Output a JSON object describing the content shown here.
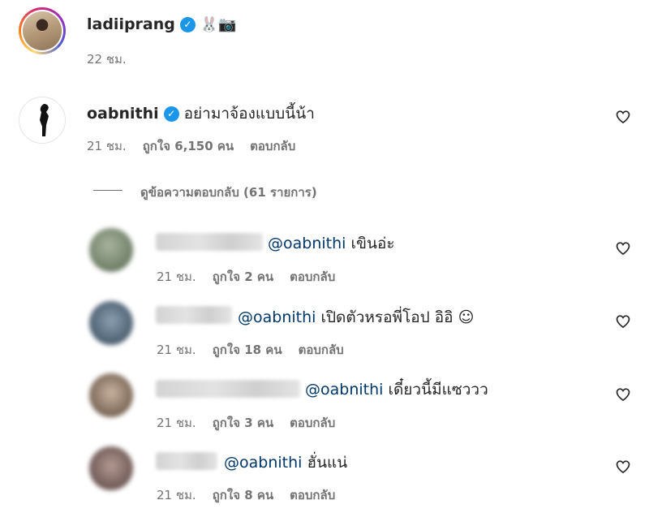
{
  "post": {
    "author": "ladiiprang",
    "emoji": "🐰📷",
    "time": "22 ชม."
  },
  "comment": {
    "author": "oabnithi",
    "text": "อย่ามาจ้องแบบนี้น้า",
    "time": "21 ชม.",
    "likes": "ถูกใจ 6,150 คน",
    "reply_label": "ตอบกลับ",
    "view_replies": "ดูข้อความตอบกลับ (61 รายการ)"
  },
  "replies": [
    {
      "mention": "@oabnithi",
      "text": "เขินอ่ะ",
      "time": "21 ชม.",
      "likes": "ถูกใจ 2 คน",
      "reply_label": "ตอบกลับ",
      "avatar_color": "#7f8f78"
    },
    {
      "mention": "@oabnithi",
      "text": "เปิดตัวหรอพี่โอป อิอิ ☺",
      "time": "21 ชม.",
      "likes": "ถูกใจ 18 คน",
      "reply_label": "ตอบกลับ",
      "avatar_color": "#566a7a"
    },
    {
      "mention": "@oabnithi",
      "text": "เดี๋ยวนี้มีแซววว",
      "time": "21 ชม.",
      "likes": "ถูกใจ 3 คน",
      "reply_label": "ตอบกลับ",
      "avatar_color": "#8a7868"
    },
    {
      "mention": "@oabnithi",
      "text": "ฮั่นแน่",
      "time": "21 ชม.",
      "likes": "ถูกใจ 8 คน",
      "reply_label": "ตอบกลับ",
      "avatar_color": "#7e6a66"
    }
  ],
  "colors": {
    "verified": "#1c96e8",
    "mention": "#00376b",
    "meta": "#737373"
  }
}
